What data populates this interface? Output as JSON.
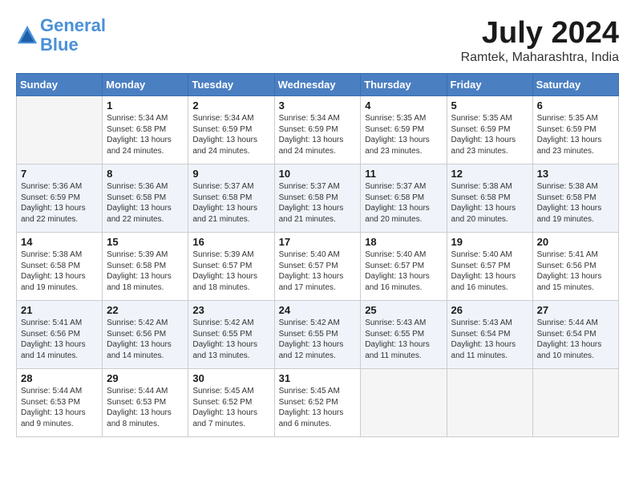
{
  "header": {
    "logo_line1": "General",
    "logo_line2": "Blue",
    "month_year": "July 2024",
    "location": "Ramtek, Maharashtra, India"
  },
  "days_of_week": [
    "Sunday",
    "Monday",
    "Tuesday",
    "Wednesday",
    "Thursday",
    "Friday",
    "Saturday"
  ],
  "weeks": [
    [
      {
        "day": "",
        "info": ""
      },
      {
        "day": "1",
        "info": "Sunrise: 5:34 AM\nSunset: 6:58 PM\nDaylight: 13 hours\nand 24 minutes."
      },
      {
        "day": "2",
        "info": "Sunrise: 5:34 AM\nSunset: 6:59 PM\nDaylight: 13 hours\nand 24 minutes."
      },
      {
        "day": "3",
        "info": "Sunrise: 5:34 AM\nSunset: 6:59 PM\nDaylight: 13 hours\nand 24 minutes."
      },
      {
        "day": "4",
        "info": "Sunrise: 5:35 AM\nSunset: 6:59 PM\nDaylight: 13 hours\nand 23 minutes."
      },
      {
        "day": "5",
        "info": "Sunrise: 5:35 AM\nSunset: 6:59 PM\nDaylight: 13 hours\nand 23 minutes."
      },
      {
        "day": "6",
        "info": "Sunrise: 5:35 AM\nSunset: 6:59 PM\nDaylight: 13 hours\nand 23 minutes."
      }
    ],
    [
      {
        "day": "7",
        "info": "Sunrise: 5:36 AM\nSunset: 6:59 PM\nDaylight: 13 hours\nand 22 minutes."
      },
      {
        "day": "8",
        "info": "Sunrise: 5:36 AM\nSunset: 6:58 PM\nDaylight: 13 hours\nand 22 minutes."
      },
      {
        "day": "9",
        "info": "Sunrise: 5:37 AM\nSunset: 6:58 PM\nDaylight: 13 hours\nand 21 minutes."
      },
      {
        "day": "10",
        "info": "Sunrise: 5:37 AM\nSunset: 6:58 PM\nDaylight: 13 hours\nand 21 minutes."
      },
      {
        "day": "11",
        "info": "Sunrise: 5:37 AM\nSunset: 6:58 PM\nDaylight: 13 hours\nand 20 minutes."
      },
      {
        "day": "12",
        "info": "Sunrise: 5:38 AM\nSunset: 6:58 PM\nDaylight: 13 hours\nand 20 minutes."
      },
      {
        "day": "13",
        "info": "Sunrise: 5:38 AM\nSunset: 6:58 PM\nDaylight: 13 hours\nand 19 minutes."
      }
    ],
    [
      {
        "day": "14",
        "info": "Sunrise: 5:38 AM\nSunset: 6:58 PM\nDaylight: 13 hours\nand 19 minutes."
      },
      {
        "day": "15",
        "info": "Sunrise: 5:39 AM\nSunset: 6:58 PM\nDaylight: 13 hours\nand 18 minutes."
      },
      {
        "day": "16",
        "info": "Sunrise: 5:39 AM\nSunset: 6:57 PM\nDaylight: 13 hours\nand 18 minutes."
      },
      {
        "day": "17",
        "info": "Sunrise: 5:40 AM\nSunset: 6:57 PM\nDaylight: 13 hours\nand 17 minutes."
      },
      {
        "day": "18",
        "info": "Sunrise: 5:40 AM\nSunset: 6:57 PM\nDaylight: 13 hours\nand 16 minutes."
      },
      {
        "day": "19",
        "info": "Sunrise: 5:40 AM\nSunset: 6:57 PM\nDaylight: 13 hours\nand 16 minutes."
      },
      {
        "day": "20",
        "info": "Sunrise: 5:41 AM\nSunset: 6:56 PM\nDaylight: 13 hours\nand 15 minutes."
      }
    ],
    [
      {
        "day": "21",
        "info": "Sunrise: 5:41 AM\nSunset: 6:56 PM\nDaylight: 13 hours\nand 14 minutes."
      },
      {
        "day": "22",
        "info": "Sunrise: 5:42 AM\nSunset: 6:56 PM\nDaylight: 13 hours\nand 14 minutes."
      },
      {
        "day": "23",
        "info": "Sunrise: 5:42 AM\nSunset: 6:55 PM\nDaylight: 13 hours\nand 13 minutes."
      },
      {
        "day": "24",
        "info": "Sunrise: 5:42 AM\nSunset: 6:55 PM\nDaylight: 13 hours\nand 12 minutes."
      },
      {
        "day": "25",
        "info": "Sunrise: 5:43 AM\nSunset: 6:55 PM\nDaylight: 13 hours\nand 11 minutes."
      },
      {
        "day": "26",
        "info": "Sunrise: 5:43 AM\nSunset: 6:54 PM\nDaylight: 13 hours\nand 11 minutes."
      },
      {
        "day": "27",
        "info": "Sunrise: 5:44 AM\nSunset: 6:54 PM\nDaylight: 13 hours\nand 10 minutes."
      }
    ],
    [
      {
        "day": "28",
        "info": "Sunrise: 5:44 AM\nSunset: 6:53 PM\nDaylight: 13 hours\nand 9 minutes."
      },
      {
        "day": "29",
        "info": "Sunrise: 5:44 AM\nSunset: 6:53 PM\nDaylight: 13 hours\nand 8 minutes."
      },
      {
        "day": "30",
        "info": "Sunrise: 5:45 AM\nSunset: 6:52 PM\nDaylight: 13 hours\nand 7 minutes."
      },
      {
        "day": "31",
        "info": "Sunrise: 5:45 AM\nSunset: 6:52 PM\nDaylight: 13 hours\nand 6 minutes."
      },
      {
        "day": "",
        "info": ""
      },
      {
        "day": "",
        "info": ""
      },
      {
        "day": "",
        "info": ""
      }
    ]
  ]
}
